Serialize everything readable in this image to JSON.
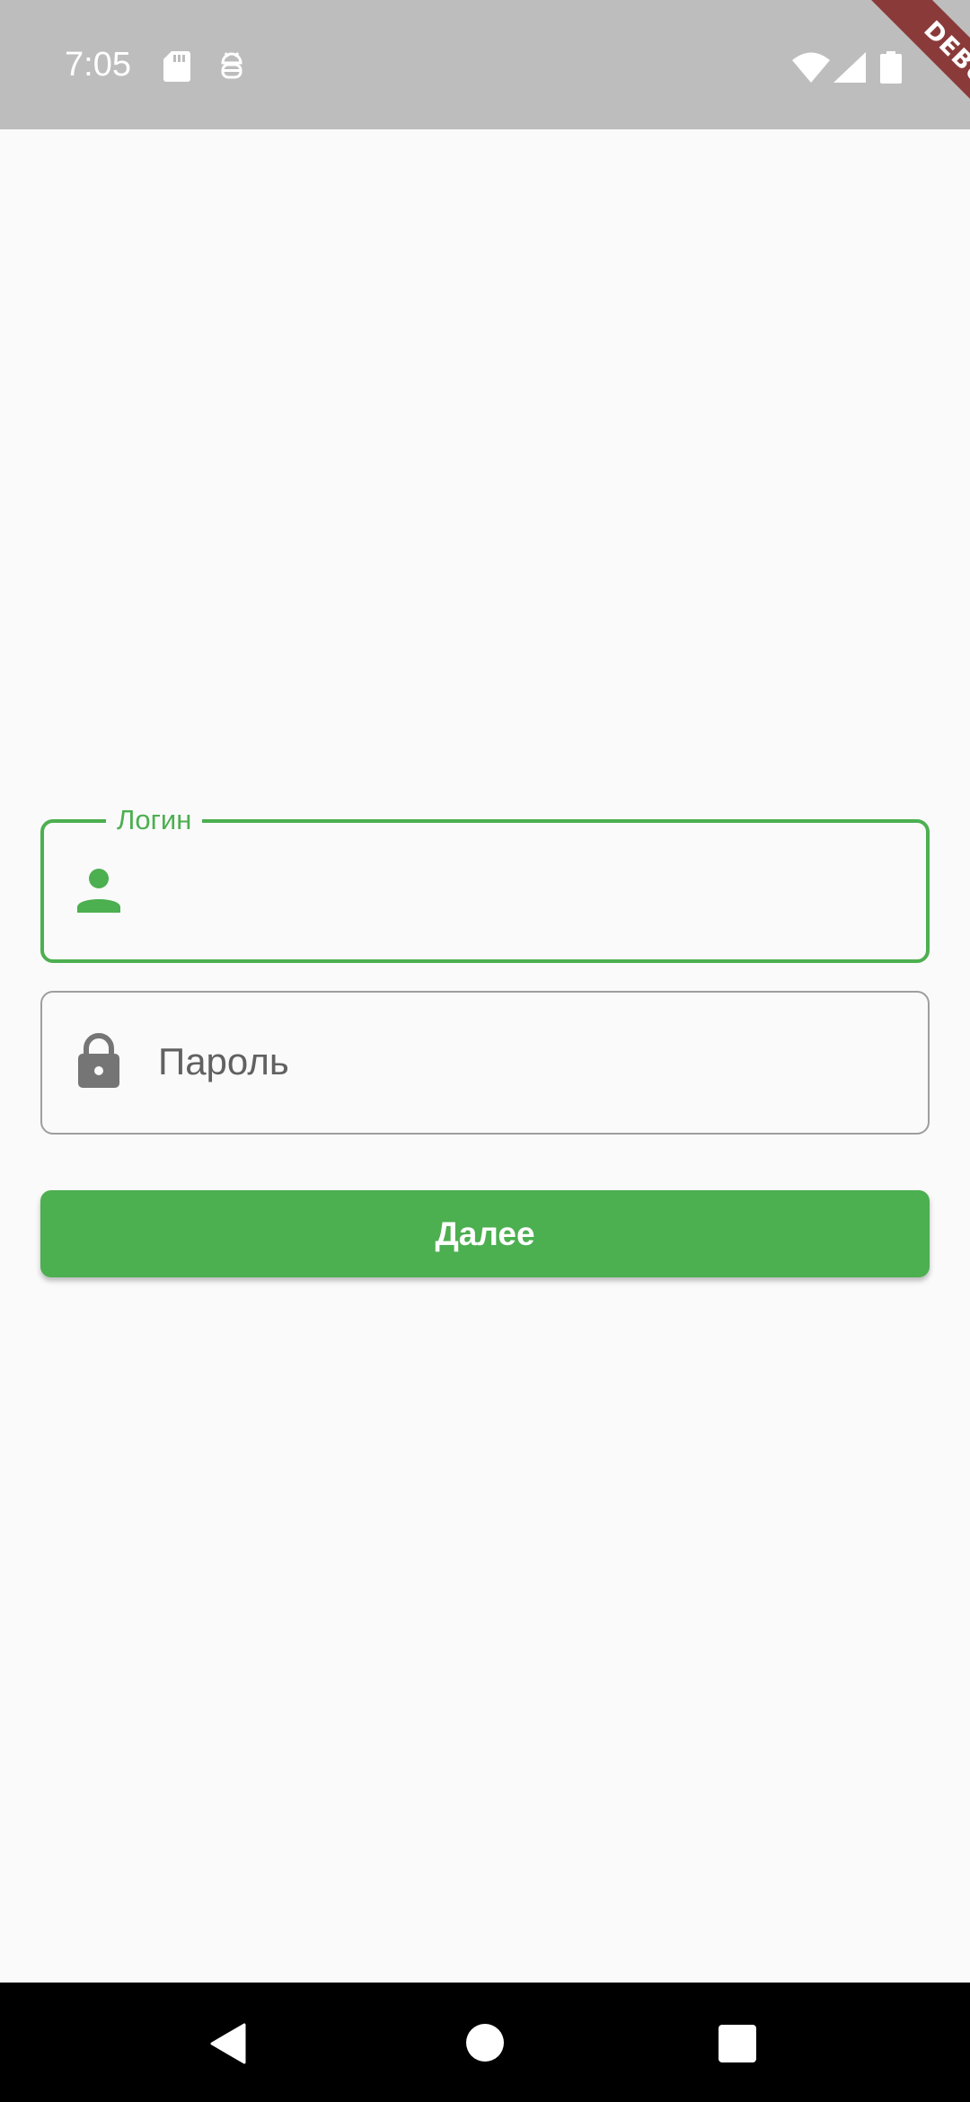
{
  "status_bar": {
    "time": "7:05",
    "icons": [
      "sd-card-icon",
      "android-debug-icon",
      "wifi-icon",
      "signal-icon",
      "battery-icon"
    ],
    "background_color": "#bdbdbd"
  },
  "debug_banner": {
    "label": "DEBUG",
    "color": "#8b3a3a"
  },
  "form": {
    "login": {
      "label": "Логин",
      "value": "",
      "icon": "person-icon",
      "focused": true
    },
    "password": {
      "placeholder": "Пароль",
      "value": "",
      "icon": "lock-icon"
    },
    "submit_label": "Далее"
  },
  "nav_bar": {
    "buttons": [
      "back-icon",
      "home-icon",
      "recents-icon"
    ]
  },
  "colors": {
    "accent": "#4caf50",
    "background": "#fafafa",
    "border_inactive": "#9e9e9e",
    "icon_inactive": "#757575"
  }
}
